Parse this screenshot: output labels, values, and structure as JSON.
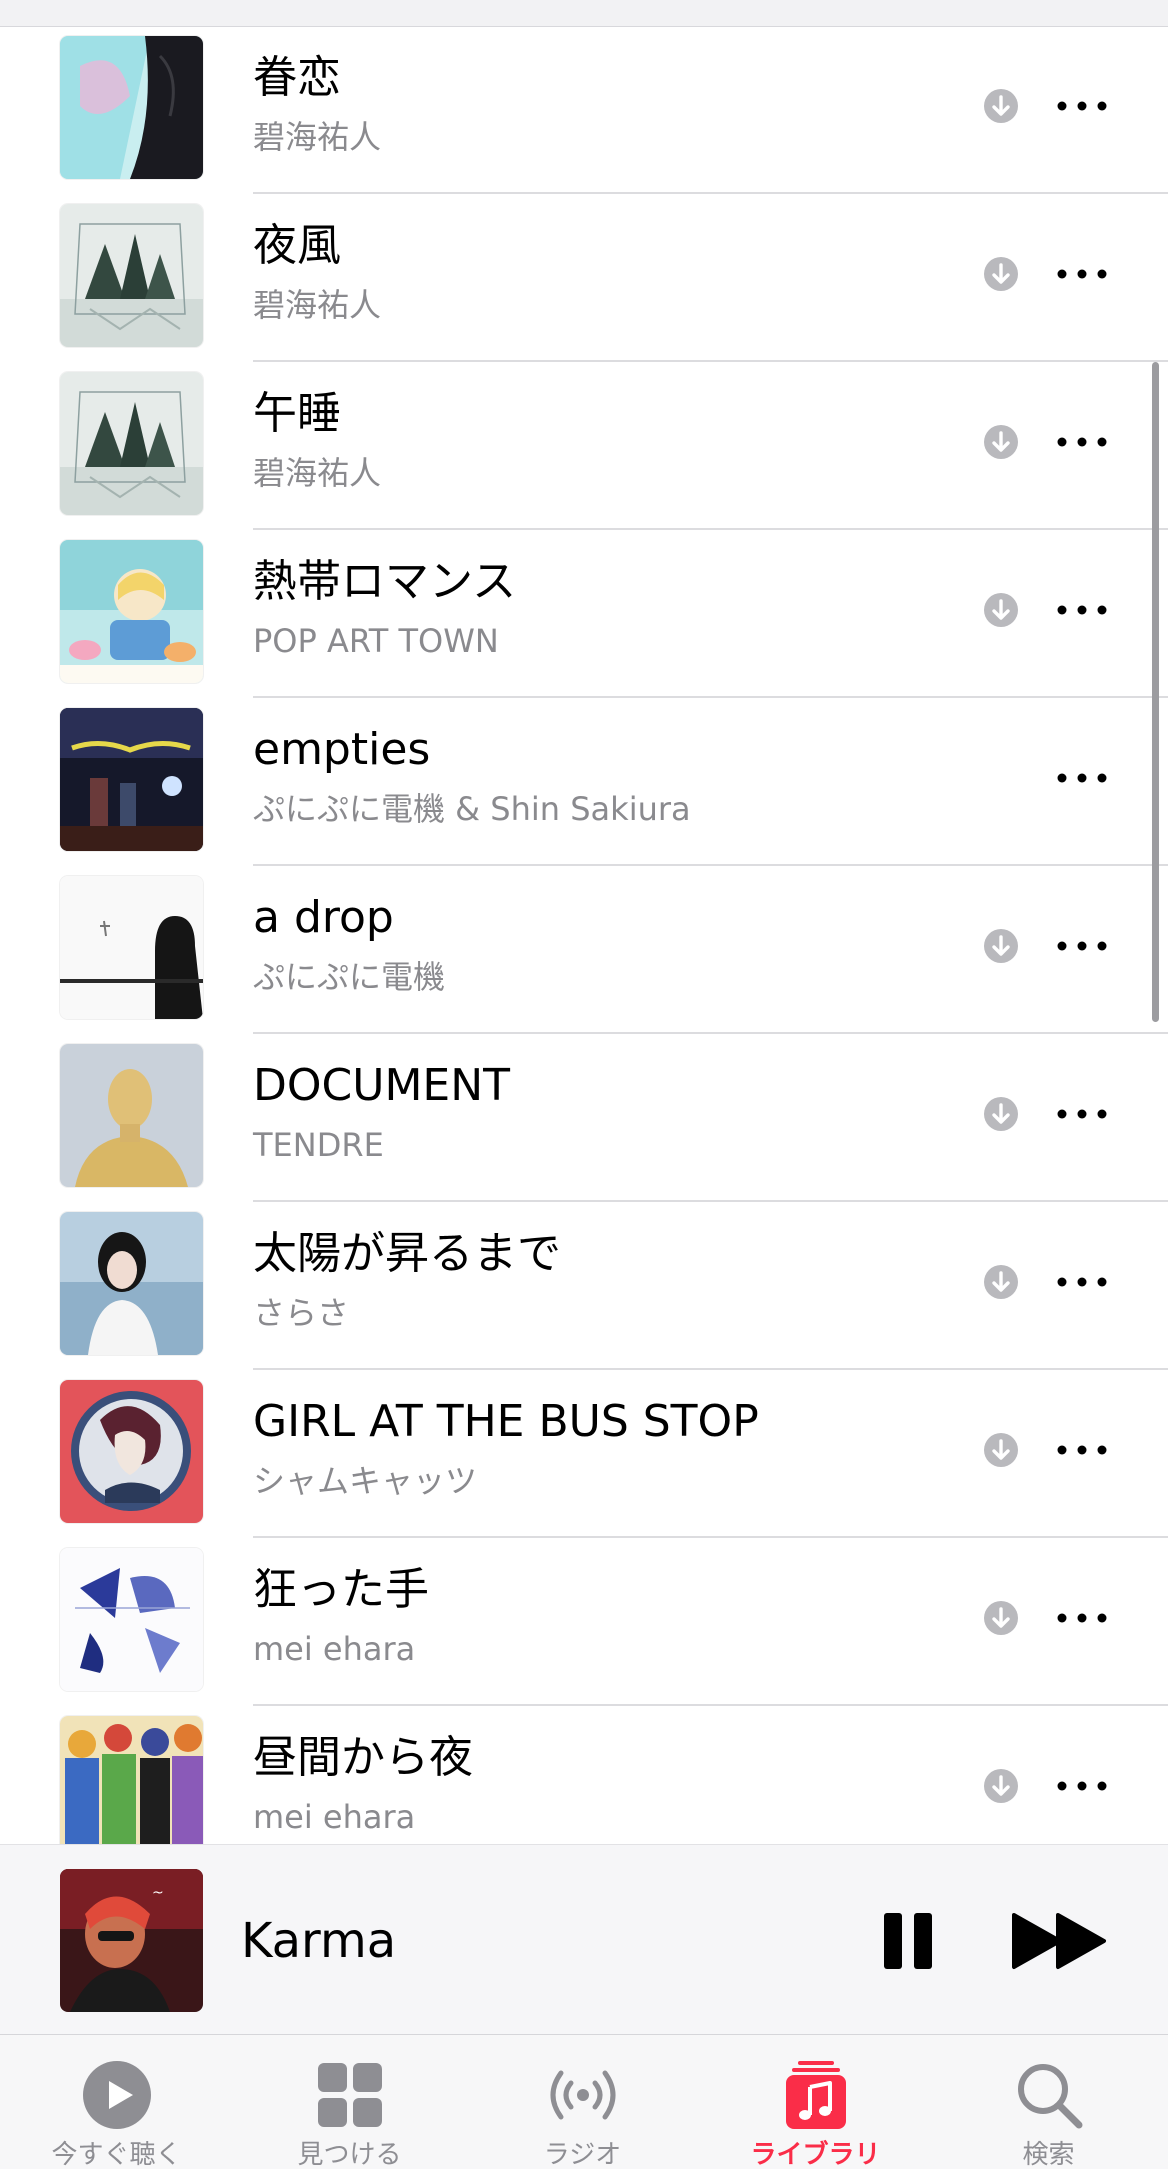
{
  "songs": [
    {
      "title": "眷恋",
      "artist": "碧海祐人",
      "downloadable": true
    },
    {
      "title": "夜風",
      "artist": "碧海祐人",
      "downloadable": true
    },
    {
      "title": "午睡",
      "artist": "碧海祐人",
      "downloadable": true
    },
    {
      "title": "熱帯ロマンス",
      "artist": "POP ART TOWN",
      "downloadable": true
    },
    {
      "title": "empties",
      "artist": "ぷにぷに電機 & Shin Sakiura",
      "downloadable": false
    },
    {
      "title": "a drop",
      "artist": "ぷにぷに電機",
      "downloadable": true
    },
    {
      "title": "DOCUMENT",
      "artist": "TENDRE",
      "downloadable": true
    },
    {
      "title": "太陽が昇るまで",
      "artist": "さらさ",
      "downloadable": true
    },
    {
      "title": "GIRL AT THE BUS STOP",
      "artist": "シャムキャッツ",
      "downloadable": true
    },
    {
      "title": "狂った手",
      "artist": "mei ehara",
      "downloadable": true
    },
    {
      "title": "昼間から夜",
      "artist": "mei ehara",
      "downloadable": true
    }
  ],
  "now_playing": {
    "title": "Karma"
  },
  "tabs": [
    {
      "label": "今すぐ聴く",
      "icon": "play-circle-icon",
      "active": false
    },
    {
      "label": "見つける",
      "icon": "grid-icon",
      "active": false
    },
    {
      "label": "ラジオ",
      "icon": "radio-icon",
      "active": false
    },
    {
      "label": "ライブラリ",
      "icon": "music-library-icon",
      "active": true
    },
    {
      "label": "検索",
      "icon": "search-icon",
      "active": false
    }
  ],
  "colors": {
    "accent": "#fa2d48",
    "secondary_text": "#8a8a8e",
    "icon_gray": "#8e8e93"
  }
}
